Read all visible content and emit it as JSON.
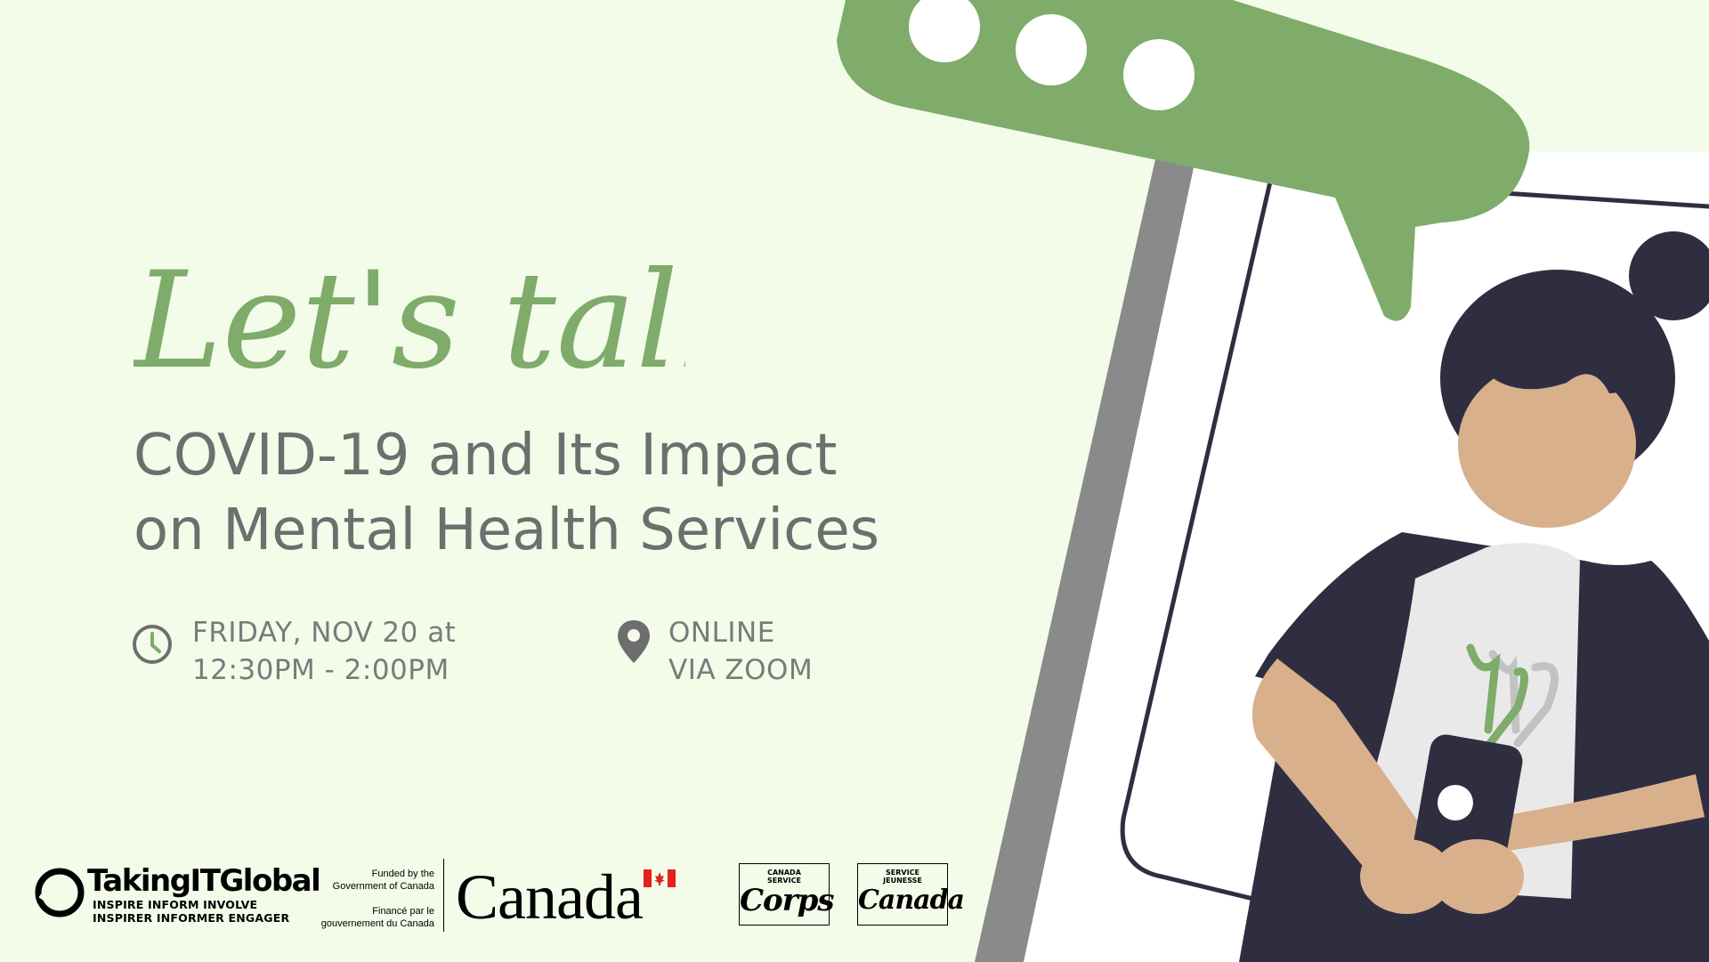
{
  "title_script": "Let's talk:",
  "headline": {
    "line1": "COVID-19 and Its Impact",
    "line2": "on Mental Health Services"
  },
  "event": {
    "time_line1": "FRIDAY, NOV 20 at",
    "time_line2": "12:30PM - 2:00PM",
    "location_line1": "ONLINE",
    "location_line2": "VIA ZOOM"
  },
  "logos": {
    "tig_name": "TakingITGlobal",
    "tig_line1": "INSPIRE INFORM INVOLVE",
    "tig_line2": "INSPIRER INFORMER ENGAGER",
    "gov_funded": "Funded by the\nGovernment of Canada",
    "gov_finance": "Financé par le\ngouvernement du Canada",
    "gov_wordmark": "Canada",
    "corps_en_small": "CANADA\nSERVICE",
    "corps_en_big": "Corps",
    "corps_fr_small": "SERVICE\nJEUNESSE",
    "corps_fr_big": "Canada"
  },
  "icons": {
    "clock": "clock-icon",
    "location": "location-pin-icon",
    "speech": "speech-bubble-icon",
    "psi": "psi-symbol-icon"
  },
  "colors": {
    "background": "#f3fbe9",
    "accent_green": "#7fab6b",
    "text_gray": "#6e6e6e",
    "navy": "#2f2e41",
    "skin": "#d8b08c",
    "phone_gray": "#8a8a8a"
  }
}
